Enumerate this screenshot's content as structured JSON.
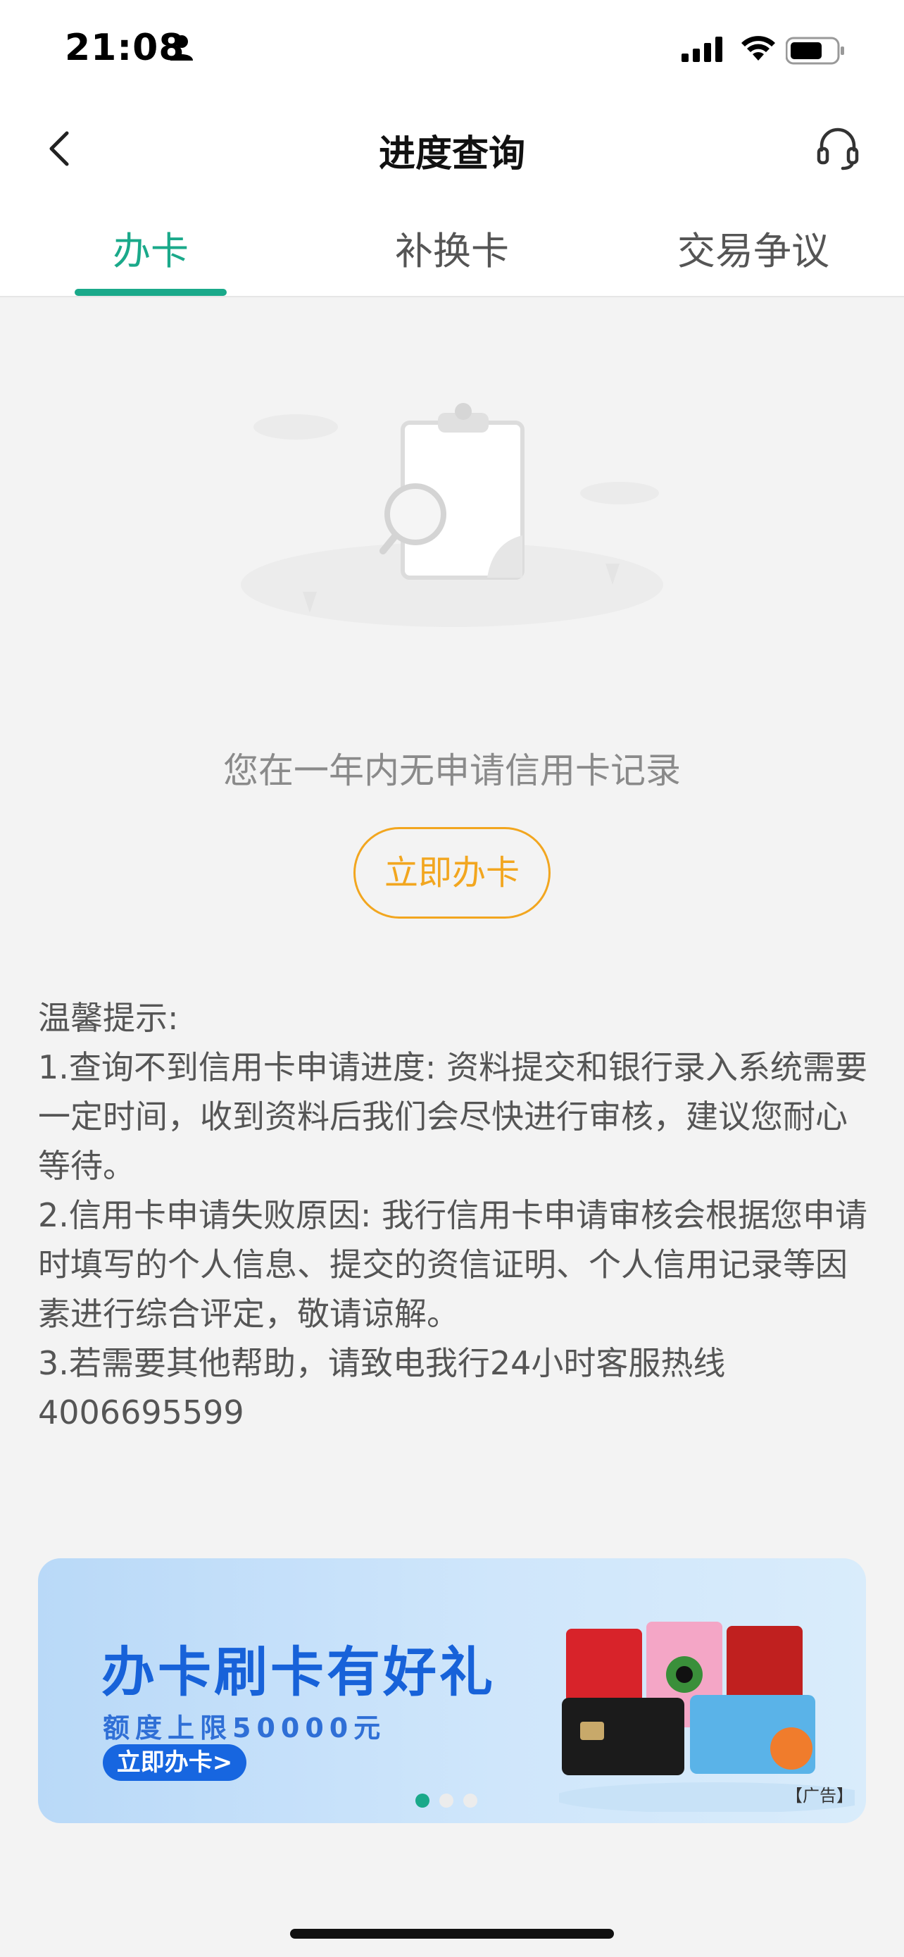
{
  "status_bar": {
    "time": "21:08"
  },
  "nav": {
    "title": "进度查询"
  },
  "tabs": [
    {
      "label": "办卡",
      "active": true
    },
    {
      "label": "补换卡",
      "active": false
    },
    {
      "label": "交易争议",
      "active": false
    }
  ],
  "empty_state": {
    "message": "您在一年内无申请信用卡记录",
    "button_label": "立即办卡"
  },
  "tips": {
    "heading": "温馨提示:",
    "items": [
      "1.查询不到信用卡申请进度: 资料提交和银行录入系统需要一定时间，收到资料后我们会尽快进行审核，建议您耐心等待。",
      "2.信用卡申请失败原因: 我行信用卡申请审核会根据您申请时填写的个人信息、提交的资信证明、个人信用记录等因素进行综合评定，敬请谅解。",
      "3.若需要其他帮助，请致电我行24小时客服热线4006695599"
    ]
  },
  "banner": {
    "title": "办卡刷卡有好礼",
    "subtitle": "额度上限50000元",
    "button_label": "立即办卡>",
    "ad_tag": "【广告】",
    "page_count": 3,
    "active_page": 1
  },
  "colors": {
    "accent": "#1aa98a",
    "button_orange": "#f2a61f",
    "banner_blue": "#1762d9"
  }
}
